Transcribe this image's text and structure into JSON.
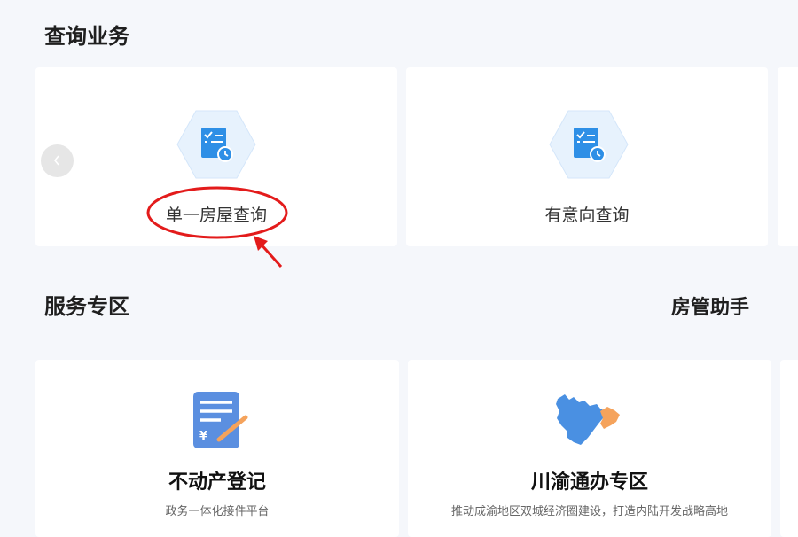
{
  "query_section": {
    "title": "查询业务",
    "cards": [
      {
        "label": "单一房屋查询",
        "icon": "document-clock-icon"
      },
      {
        "label": "有意向查询",
        "icon": "document-clock-icon"
      }
    ],
    "prev_icon": "chevron-left-icon"
  },
  "service_section": {
    "title": "服务专区",
    "side_title": "房管助手",
    "cards": [
      {
        "title": "不动产登记",
        "desc": "政务一体化接件平台",
        "icon": "yuan-document-pen-icon"
      },
      {
        "title": "川渝通办专区",
        "desc": "推动成渝地区双城经济圈建设，打造内陆开发战略高地",
        "icon": "sichuan-chongqing-map-icon"
      }
    ]
  },
  "colors": {
    "background": "#f5f7fb",
    "card": "#ffffff",
    "icon_blue": "#2e8fe6",
    "hex_fill": "#e7f2fd",
    "map_blue": "#4a90e2",
    "map_orange": "#f5a35c",
    "annotation_red": "#e31b1b"
  }
}
